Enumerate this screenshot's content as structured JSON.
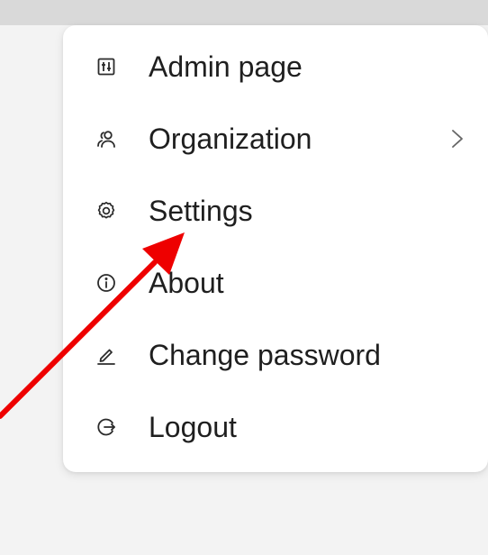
{
  "menu": {
    "items": [
      {
        "id": "admin",
        "label": "Admin page",
        "icon": "admin-sliders-icon"
      },
      {
        "id": "organization",
        "label": "Organization",
        "icon": "users-icon",
        "has_submenu": true
      },
      {
        "id": "settings",
        "label": "Settings",
        "icon": "gear-icon"
      },
      {
        "id": "about",
        "label": "About",
        "icon": "info-icon"
      },
      {
        "id": "change-password",
        "label": "Change password",
        "icon": "pencil-icon"
      },
      {
        "id": "logout",
        "label": "Logout",
        "icon": "logout-icon"
      }
    ]
  },
  "annotation": {
    "arrow_color": "#ee0000"
  },
  "colors": {
    "text": "#1f1f1f",
    "icon": "#2b2b2b",
    "menu_bg": "#ffffff",
    "page_bg": "#f3f3f3",
    "top_bar": "#d9d9d9"
  }
}
